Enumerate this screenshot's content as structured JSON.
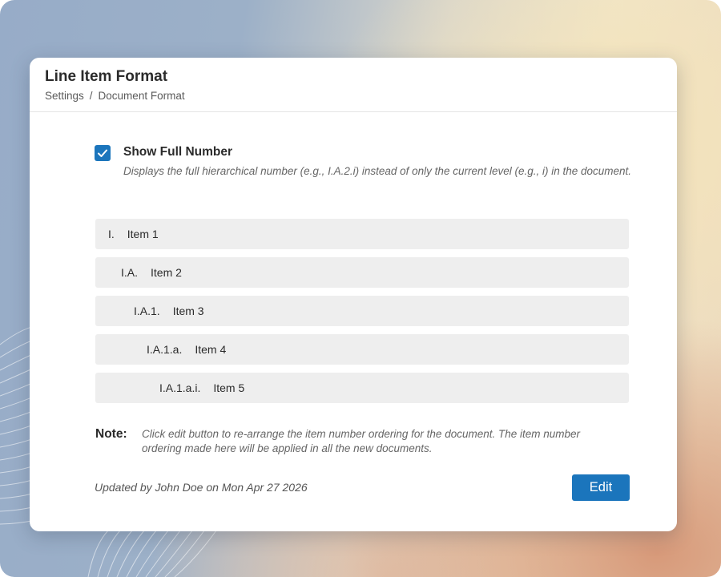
{
  "header": {
    "title": "Line Item Format",
    "breadcrumb": [
      "Settings",
      "Document Format"
    ],
    "breadcrumb_separator": "/"
  },
  "show_full_number": {
    "checked": true,
    "label": "Show Full Number",
    "description": "Displays the full hierarchical number (e.g., I.A.2.i) instead of only the current level (e.g., i) in the document."
  },
  "items": [
    {
      "number": "I.",
      "label": "Item 1",
      "level": 0
    },
    {
      "number": "I.A.",
      "label": "Item 2",
      "level": 1
    },
    {
      "number": "I.A.1.",
      "label": "Item 3",
      "level": 2
    },
    {
      "number": "I.A.1.a.",
      "label": "Item 4",
      "level": 3
    },
    {
      "number": "I.A.1.a.i.",
      "label": "Item 5",
      "level": 4
    }
  ],
  "note": {
    "label": "Note:",
    "text": "Click edit button to re-arrange the item number ordering for the document. The item number ordering made here will be applied in all the new documents."
  },
  "footer": {
    "updated_text": "Updated by John Doe on Mon Apr 27 2026",
    "edit_label": "Edit"
  },
  "colors": {
    "accent": "#1b75bc",
    "row_bg": "#eeeeee"
  }
}
